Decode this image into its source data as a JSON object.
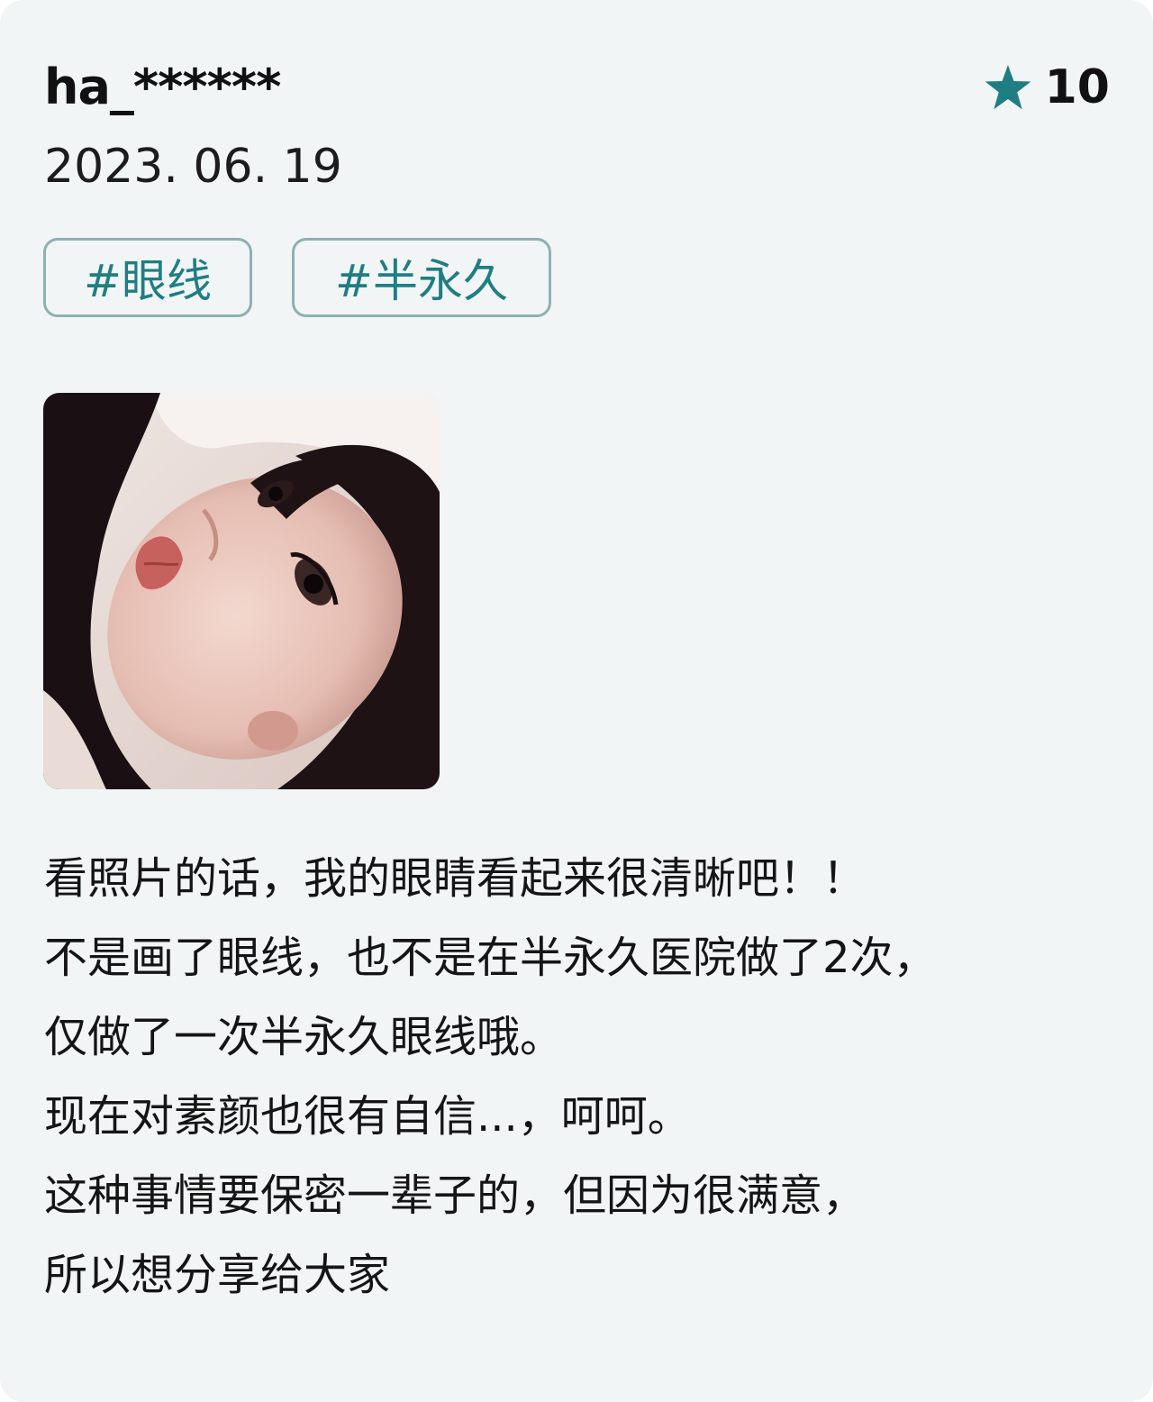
{
  "review": {
    "username": "ha_******",
    "date": "2023. 06. 19",
    "rating": "10",
    "rating_icon": "star-icon",
    "accent_color": "#1f7e83",
    "tags": [
      "#眼线",
      "#半永久"
    ],
    "photo": "face-photo",
    "body_lines": [
      "看照片的话，我的眼睛看起来很清晰吧！！",
      "不是画了眼线，也不是在半永久医院做了2次，",
      "仅做了一次半永久眼线哦。",
      "现在对素颜也很有自信...，呵呵。",
      "这种事情要保密一辈子的，但因为很满意，",
      "所以想分享给大家"
    ]
  }
}
